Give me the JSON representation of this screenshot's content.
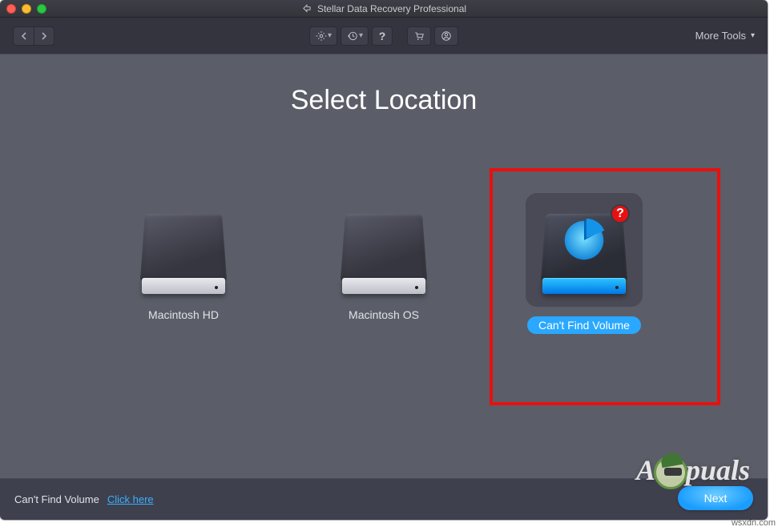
{
  "app_title": "Stellar Data Recovery Professional",
  "toolbar": {
    "more_tools": "More Tools"
  },
  "heading": "Select Location",
  "drives": [
    {
      "label": "Macintosh HD"
    },
    {
      "label": "Macintosh OS"
    },
    {
      "label": "Can't Find Volume"
    }
  ],
  "footer": {
    "text": "Can't Find Volume",
    "link": "Click here"
  },
  "next": "Next",
  "watermark": "wsxdn.com",
  "badge": "?"
}
